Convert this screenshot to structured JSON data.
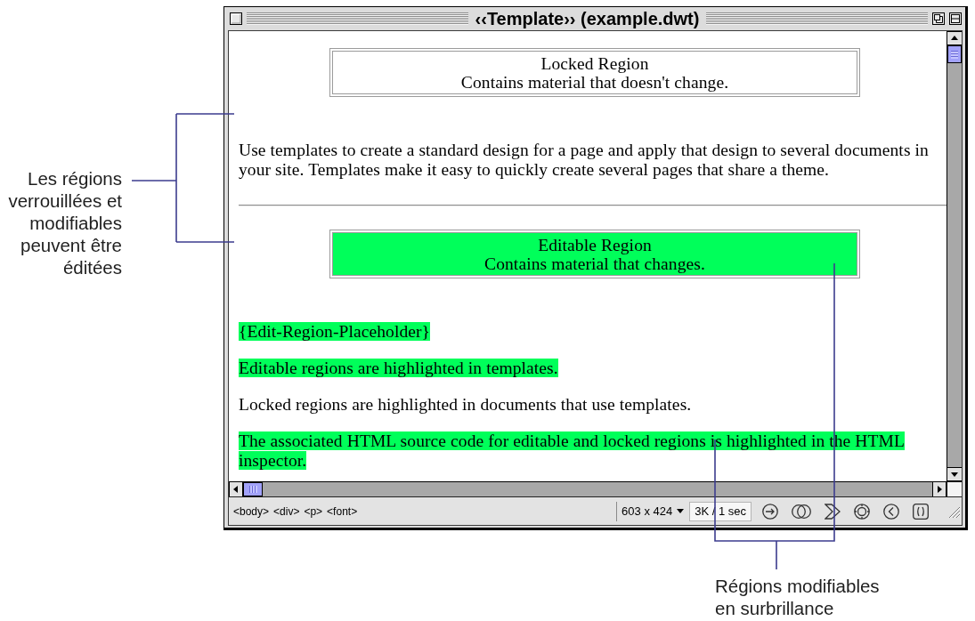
{
  "window": {
    "title": "‹‹Template›› (example.dwt)"
  },
  "document": {
    "content": [
      {
        "kind": "region",
        "title": "Locked Region",
        "description": "Contains material that doesn't change.",
        "highlighted": false
      },
      {
        "kind": "paragraph",
        "text": "Use templates to create a standard design for a page and apply that design to several documents in your site. Templates make it easy to quickly create several pages that share a theme.",
        "highlighted": false
      },
      {
        "kind": "rule"
      },
      {
        "kind": "region",
        "title": "Editable Region",
        "description": "Contains material that changes.",
        "highlighted": true
      },
      {
        "kind": "paragraph",
        "text": "{Edit-Region-Placeholder}",
        "highlighted": true
      },
      {
        "kind": "paragraph",
        "text": "Editable regions are highlighted in templates.",
        "highlighted": true
      },
      {
        "kind": "paragraph",
        "text": "Locked regions are highlighted in documents that use templates.",
        "highlighted": false
      },
      {
        "kind": "paragraph",
        "text": "The associated HTML source code for editable and locked regions is highlighted in the HTML inspector.",
        "highlighted": true
      }
    ]
  },
  "status_bar": {
    "tag_selector": [
      "<body>",
      "<div>",
      "<p>",
      "<font>"
    ],
    "window_size": "603 x 424",
    "download_stats": "3K / 1 sec"
  },
  "callouts": [
    {
      "text": "Les régions verrouillées et modifiables peuvent être éditées"
    },
    {
      "text": "Régions modifiables en surbrillance"
    }
  ]
}
